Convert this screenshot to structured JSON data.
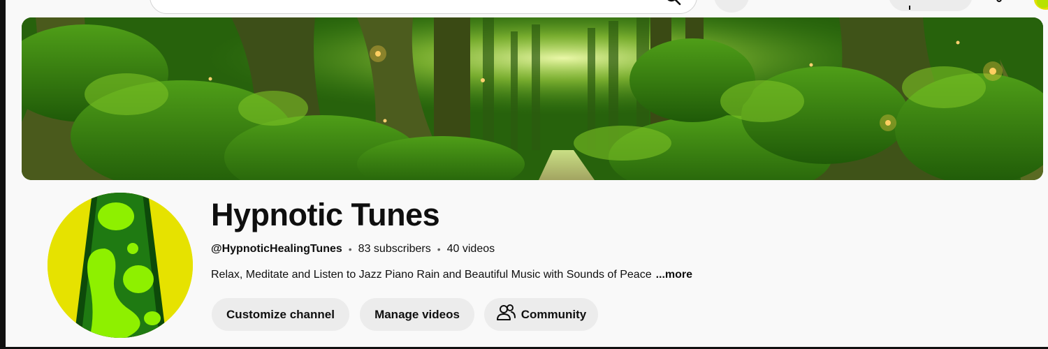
{
  "header": {
    "search": {
      "placeholder": ""
    }
  },
  "banner": {
    "description_visible": false
  },
  "channel": {
    "name": "Hypnotic Tunes",
    "handle": "@HypnoticHealingTunes",
    "separator": "•",
    "subscribers": "83 subscribers",
    "videos": "40 videos",
    "description": "Relax, Meditate and Listen to Jazz Piano Rain and Beautiful Music with Sounds of Peace",
    "more_label": "...more"
  },
  "actions": {
    "customize_label": "Customize channel",
    "manage_label": "Manage videos",
    "community_label": "Community"
  },
  "colors": {
    "background": "#f9f9f9",
    "button_bg": "#ececec",
    "text": "#0f0f0f",
    "avatar_lamp_green": "#8ef000",
    "avatar_bg_yellow": "#e6e200"
  }
}
